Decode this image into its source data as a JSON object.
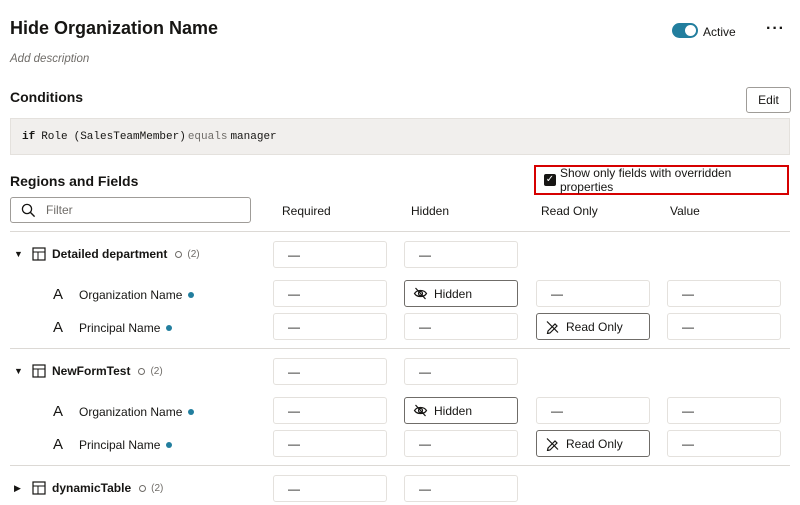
{
  "header": {
    "title": "Hide Organization Name",
    "description_placeholder": "Add description",
    "status_label": "Active",
    "more_label": "···"
  },
  "conditions": {
    "heading": "Conditions",
    "edit_label": "Edit",
    "if_kw": "if",
    "field": "Role",
    "field_id": "(SalesTeamMember)",
    "operator": "equals",
    "value": "manager"
  },
  "regions": {
    "heading": "Regions and Fields",
    "show_overridden_label": "Show only fields with overridden properties",
    "show_overridden_checked": true,
    "filter_placeholder": "Filter",
    "columns": [
      "Required",
      "Hidden",
      "Read Only",
      "Value"
    ],
    "empty_value": "—",
    "groups": [
      {
        "name": "Detailed department",
        "count": "(2)",
        "required": "—",
        "hidden": "—",
        "fields": [
          {
            "name": "Organization Name",
            "required": "—",
            "hidden": "Hidden",
            "read_only": "—",
            "value": "—"
          },
          {
            "name": "Principal Name",
            "required": "—",
            "hidden": "—",
            "read_only": "Read Only",
            "value": "—"
          }
        ]
      },
      {
        "name": "NewFormTest",
        "count": "(2)",
        "required": "—",
        "hidden": "—",
        "fields": [
          {
            "name": "Organization Name",
            "required": "—",
            "hidden": "Hidden",
            "read_only": "—",
            "value": "—"
          },
          {
            "name": "Principal Name",
            "required": "—",
            "hidden": "—",
            "read_only": "Read Only",
            "value": "—"
          }
        ]
      },
      {
        "name": "dynamicTable",
        "count": "(2)",
        "required": "—",
        "hidden": "—",
        "fields": []
      }
    ]
  },
  "icons": {
    "field_glyph": "A",
    "caret_expanded": "▼",
    "caret_collapsed": "▶"
  },
  "colors": {
    "accent": "#227e9e",
    "highlight_border": "#d60000"
  }
}
